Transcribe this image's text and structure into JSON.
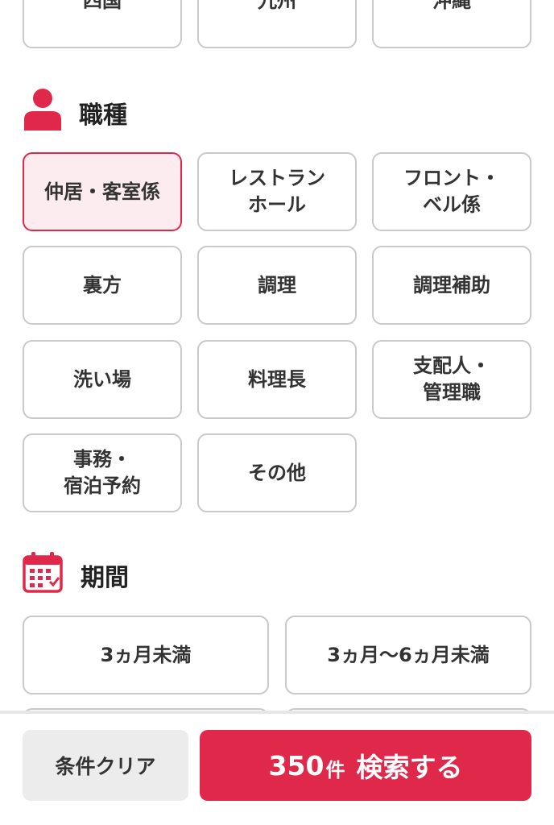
{
  "regions": {
    "items": [
      {
        "label": "四国",
        "selected": false
      },
      {
        "label": "九州",
        "selected": false
      },
      {
        "label": "沖縄",
        "selected": false
      }
    ]
  },
  "job_type": {
    "title": "職種",
    "icon": "person-icon",
    "items": [
      {
        "label": "仲居・客室係",
        "selected": true
      },
      {
        "label": "レストラン\nホール",
        "selected": false
      },
      {
        "label": "フロント・\nベル係",
        "selected": false
      },
      {
        "label": "裏方",
        "selected": false
      },
      {
        "label": "調理",
        "selected": false
      },
      {
        "label": "調理補助",
        "selected": false
      },
      {
        "label": "洗い場",
        "selected": false
      },
      {
        "label": "料理長",
        "selected": false
      },
      {
        "label": "支配人・\n管理職",
        "selected": false
      },
      {
        "label": "事務・\n宿泊予約",
        "selected": false
      },
      {
        "label": "その他",
        "selected": false
      }
    ]
  },
  "period": {
    "title": "期間",
    "icon": "calendar-icon",
    "items": [
      {
        "label": "3ヵ月未満",
        "selected": false
      },
      {
        "label": "3ヵ月〜6ヵ月未満",
        "selected": false
      }
    ]
  },
  "bottom_bar": {
    "clear_label": "条件クリア",
    "result_count": "350",
    "result_unit": "件",
    "search_label": "検索する"
  },
  "colors": {
    "accent": "#e0294a",
    "selected_bg": "#fdecef",
    "chip_border": "#c9c9c9"
  }
}
